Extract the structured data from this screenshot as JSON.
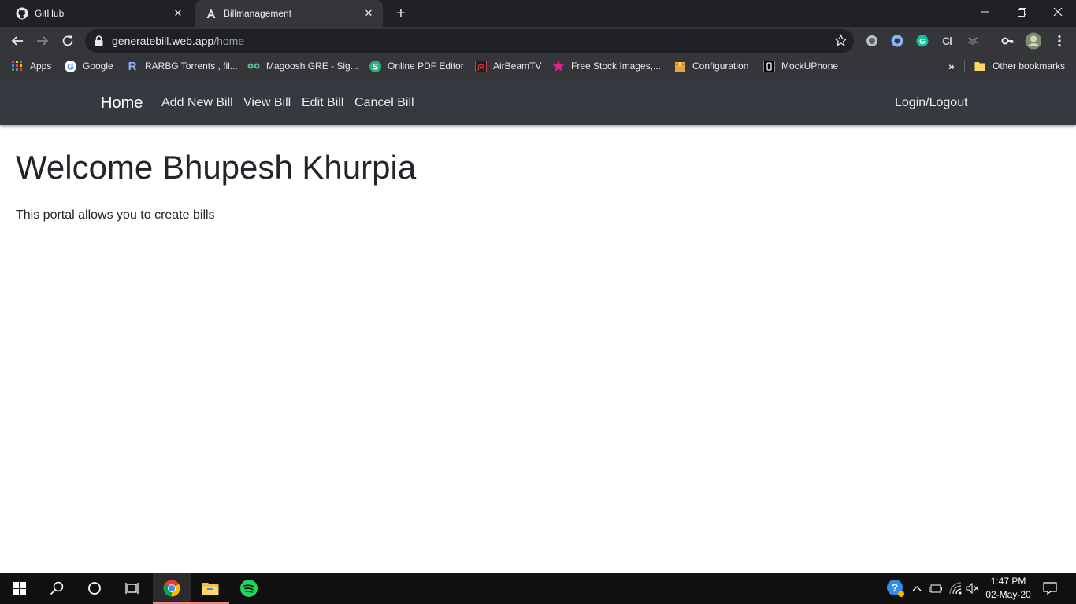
{
  "browser": {
    "tabs": [
      {
        "title": "GitHub",
        "favicon": "github-icon"
      },
      {
        "title": "Billmanagement",
        "favicon": "angular-icon"
      }
    ],
    "url": {
      "domain": "generatebill.web.app",
      "path": "/home"
    }
  },
  "bookmarks": {
    "items": [
      {
        "label": "Apps",
        "icon": "apps-grid-icon"
      },
      {
        "label": "Google",
        "icon": "google-icon"
      },
      {
        "label": "RARBG Torrents , fil...",
        "icon": "rarbg-icon"
      },
      {
        "label": "Magoosh GRE - Sig...",
        "icon": "magoosh-icon"
      },
      {
        "label": "Online PDF Editor",
        "icon": "sejda-icon"
      },
      {
        "label": "AirBeamTV",
        "icon": "airbeam-icon"
      },
      {
        "label": "Free Stock Images,...",
        "icon": "star-icon"
      },
      {
        "label": "Configuration",
        "icon": "package-icon"
      },
      {
        "label": "MockUPhone",
        "icon": "phone-icon"
      }
    ],
    "overflow": "»",
    "other": "Other bookmarks"
  },
  "navbar": {
    "brand": "Home",
    "links": [
      "Add New Bill",
      "View Bill",
      "Edit Bill",
      "Cancel Bill"
    ],
    "login": "Login/Logout"
  },
  "main": {
    "heading": "Welcome Bhupesh Khurpia",
    "description": "This portal allows you to create bills"
  },
  "taskbar": {
    "time": "1:47 PM",
    "date": "02-May-20"
  },
  "colors": {
    "navbar_bg": "#343a40",
    "chrome_dark": "#202124",
    "chrome_toolbar": "#35363a",
    "taskbar_bg": "#101010"
  }
}
